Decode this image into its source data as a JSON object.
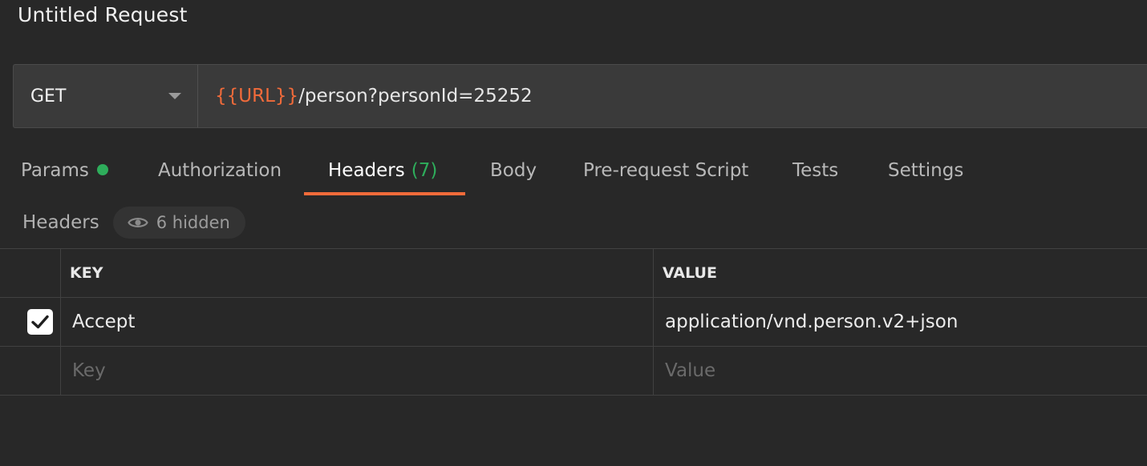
{
  "request": {
    "title": "Untitled Request",
    "method": "GET",
    "url_variable": "{{URL}}",
    "url_path": "/person?personId=25252"
  },
  "tabs": {
    "params": "Params",
    "authorization": "Authorization",
    "headers": "Headers",
    "headers_count": "(7)",
    "body": "Body",
    "prerequest": "Pre-request Script",
    "tests": "Tests",
    "settings": "Settings"
  },
  "headers_section": {
    "title": "Headers",
    "hidden_label": "6 hidden"
  },
  "table": {
    "columns": {
      "key": "KEY",
      "value": "VALUE"
    },
    "rows": [
      {
        "checked": true,
        "key": "Accept",
        "value": "application/vnd.person.v2+json"
      }
    ],
    "new_row": {
      "key_placeholder": "Key",
      "value_placeholder": "Value"
    }
  },
  "icons": {
    "method_dropdown": "chevron-down-icon",
    "params_indicator": "dot-indicator-icon",
    "hidden_toggle": "eye-icon",
    "checkbox": "checkmark-icon"
  },
  "colors": {
    "background": "#282828",
    "accent": "#f26b3a",
    "success": "#2ead5b"
  }
}
